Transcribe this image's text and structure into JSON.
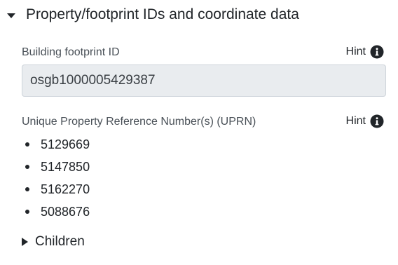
{
  "section": {
    "title": "Property/footprint IDs and coordinate data"
  },
  "footprint": {
    "label": "Building footprint ID",
    "hint_label": "Hint",
    "value": "osgb1000005429387"
  },
  "uprn": {
    "label": "Unique Property Reference Number(s) (UPRN)",
    "hint_label": "Hint",
    "items": [
      "5129669",
      "5147850",
      "5162270",
      "5088676"
    ]
  },
  "children": {
    "label": "Children"
  },
  "icons": {
    "section_toggle": "caret-down-icon",
    "hint": "info-circle-icon",
    "children_toggle": "caret-right-icon"
  }
}
